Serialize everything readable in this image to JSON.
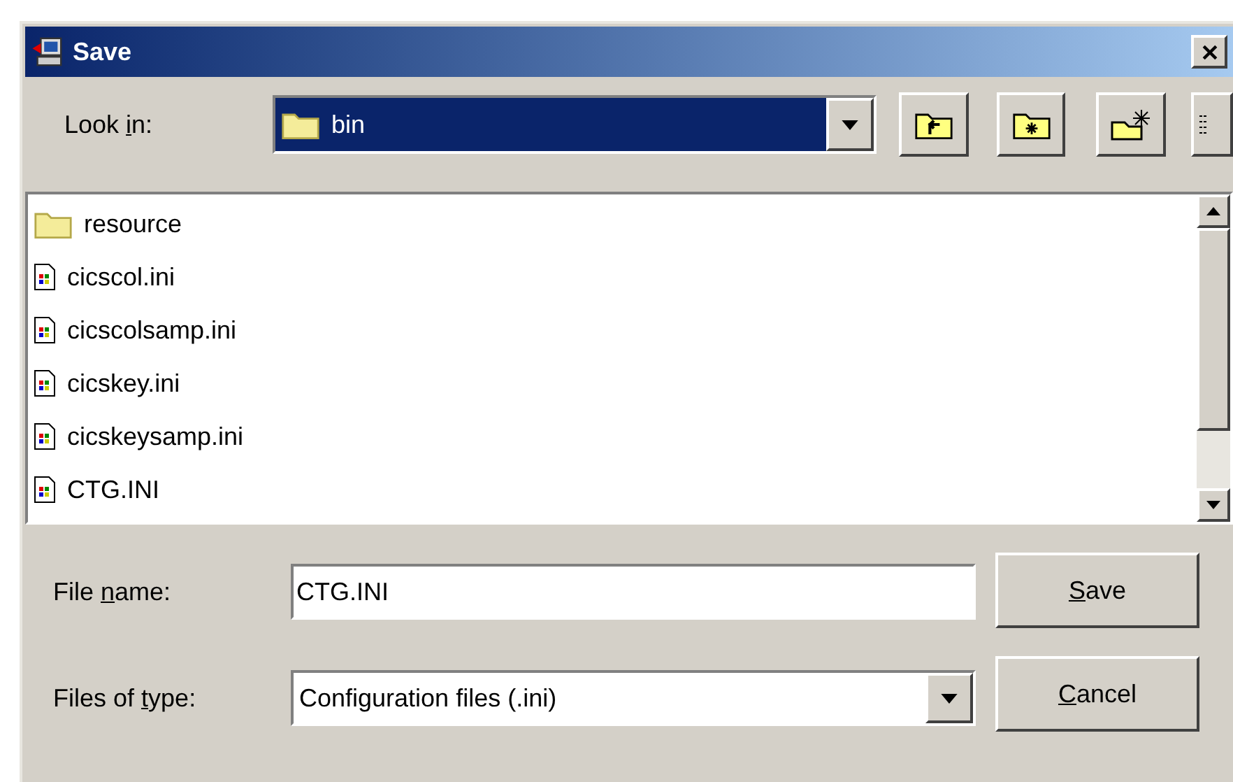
{
  "window": {
    "title": "Save"
  },
  "look_in": {
    "label": {
      "before": "Look ",
      "key": "i",
      "after": "n:"
    },
    "value": "bin"
  },
  "files": [
    {
      "kind": "folder",
      "name": "resource"
    },
    {
      "kind": "file",
      "name": "cicscol.ini"
    },
    {
      "kind": "file",
      "name": "cicscolsamp.ini"
    },
    {
      "kind": "file",
      "name": "cicskey.ini"
    },
    {
      "kind": "file",
      "name": "cicskeysamp.ini"
    },
    {
      "kind": "file",
      "name": "CTG.INI"
    }
  ],
  "file_name": {
    "label": {
      "before": "File ",
      "key": "n",
      "after": "ame:"
    },
    "value": "CTG.INI"
  },
  "file_type": {
    "label": {
      "before": "Files of ",
      "key": "t",
      "after": "ype:"
    },
    "value": "Configuration files (.ini)"
  },
  "buttons": [
    {
      "label": {
        "key": "S",
        "after": "ave"
      }
    },
    {
      "label": {
        "key": "C",
        "after": "ancel"
      }
    }
  ]
}
